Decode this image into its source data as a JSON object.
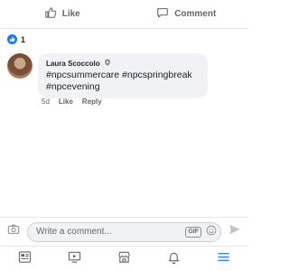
{
  "actions": {
    "like_label": "Like",
    "comment_label": "Comment"
  },
  "reactions": {
    "count": "1",
    "type": "like",
    "color": "#1877f2"
  },
  "comment": {
    "author": "Laura Scoccolo",
    "text": "#npcsummercare #npcspringbreak #npcevening",
    "time": "5d",
    "like_label": "Like",
    "reply_label": "Reply"
  },
  "composer": {
    "placeholder": "Write a comment...",
    "gif_label": "GIF"
  },
  "tabs": [
    {
      "icon": "news-feed-icon"
    },
    {
      "icon": "watch-icon"
    },
    {
      "icon": "marketplace-icon"
    },
    {
      "icon": "notifications-bell-icon"
    },
    {
      "icon": "menu-icon",
      "color": "#1877f2"
    }
  ]
}
